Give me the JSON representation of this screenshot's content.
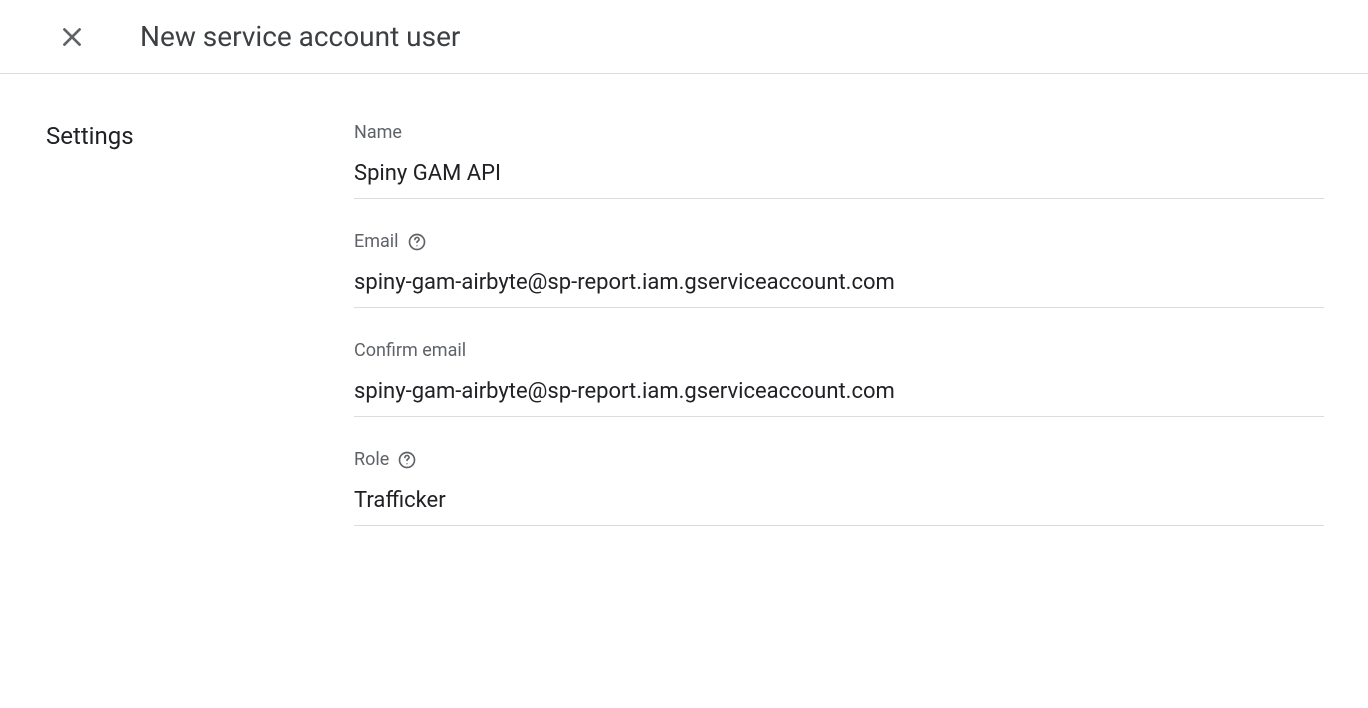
{
  "header": {
    "title": "New service account user"
  },
  "sidebar": {
    "section_label": "Settings"
  },
  "form": {
    "name": {
      "label": "Name",
      "value": "Spiny GAM API"
    },
    "email": {
      "label": "Email",
      "value": "spiny-gam-airbyte@sp-report.iam.gserviceaccount.com"
    },
    "confirm_email": {
      "label": "Confirm email",
      "value": "spiny-gam-airbyte@sp-report.iam.gserviceaccount.com"
    },
    "role": {
      "label": "Role",
      "value": "Trafficker"
    }
  }
}
